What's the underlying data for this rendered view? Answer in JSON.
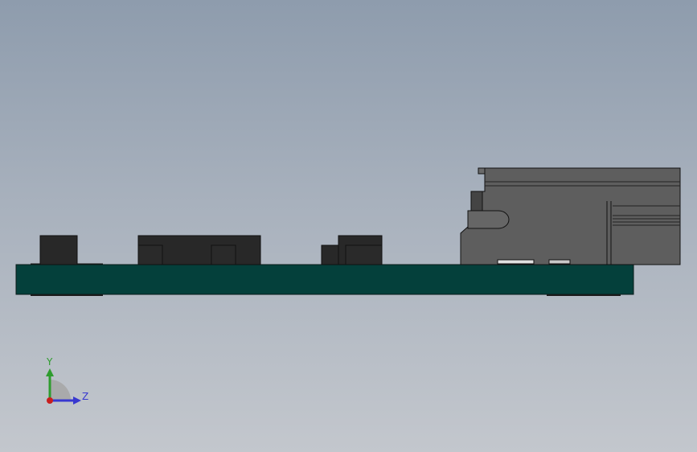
{
  "viewport": {
    "background_top": "#8e9cad",
    "background_bottom": "#c3c7cd"
  },
  "model": {
    "pcb_color": "#04403b",
    "component_color": "#282828",
    "housing_color": "#5e5e5e"
  },
  "triad": {
    "y_label": "Y",
    "z_label": "Z",
    "y_color": "#2e9c2e",
    "z_color": "#3838d0",
    "x_color": "#c81e1e"
  }
}
